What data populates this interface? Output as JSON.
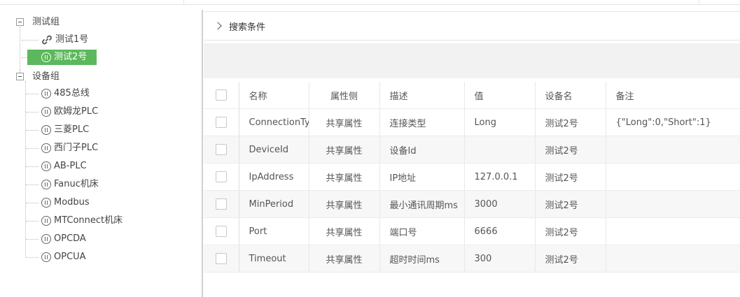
{
  "tree": {
    "groups": [
      {
        "label": "测试组",
        "children": [
          {
            "label": "测试1号",
            "icon": "link-icon",
            "selected": false
          },
          {
            "label": "测试2号",
            "icon": "pause-circle-icon",
            "selected": true
          }
        ]
      },
      {
        "label": "设备组",
        "children": [
          {
            "label": "485总线",
            "icon": "pause-circle-icon"
          },
          {
            "label": "欧姆龙PLC",
            "icon": "pause-circle-icon"
          },
          {
            "label": "三菱PLC",
            "icon": "pause-circle-icon"
          },
          {
            "label": "西门子PLC",
            "icon": "pause-circle-icon"
          },
          {
            "label": "AB-PLC",
            "icon": "pause-circle-icon"
          },
          {
            "label": "Fanuc机床",
            "icon": "pause-circle-icon"
          },
          {
            "label": "Modbus",
            "icon": "pause-circle-icon"
          },
          {
            "label": "MTConnect机床",
            "icon": "pause-circle-icon"
          },
          {
            "label": "OPCDA",
            "icon": "pause-circle-icon"
          },
          {
            "label": "OPCUA",
            "icon": "pause-circle-icon"
          }
        ]
      }
    ],
    "selected_color": "#5cb85c"
  },
  "search": {
    "label": "搜索条件"
  },
  "table": {
    "columns": [
      "名称",
      "属性侧",
      "描述",
      "值",
      "设备名",
      "备注"
    ],
    "rows": [
      [
        "ConnectionType",
        "共享属性",
        "连接类型",
        "Long",
        "测试2号",
        "{\"Long\":0,\"Short\":1}"
      ],
      [
        "DeviceId",
        "共享属性",
        "设备Id",
        "",
        "测试2号",
        ""
      ],
      [
        "IpAddress",
        "共享属性",
        "IP地址",
        "127.0.0.1",
        "测试2号",
        ""
      ],
      [
        "MinPeriod",
        "共享属性",
        "最小通讯周期ms",
        "3000",
        "测试2号",
        ""
      ],
      [
        "Port",
        "共享属性",
        "端口号",
        "6666",
        "测试2号",
        ""
      ],
      [
        "Timeout",
        "共享属性",
        "超时时间ms",
        "300",
        "测试2号",
        ""
      ]
    ]
  }
}
